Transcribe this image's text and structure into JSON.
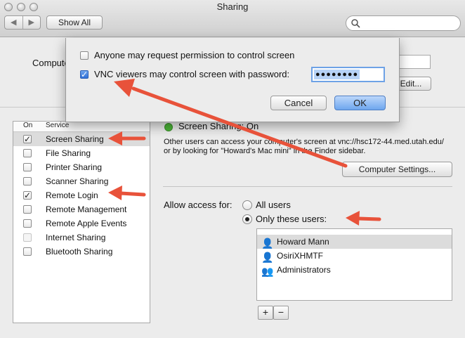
{
  "window": {
    "title": "Sharing"
  },
  "toolbar": {
    "back_icon": "chevron-left-icon",
    "forward_icon": "chevron-right-icon",
    "show_all_label": "Show All",
    "search_icon": "magnifier-icon"
  },
  "computer_name": {
    "label": "Computer Name:",
    "edit_label": "Edit..."
  },
  "services": {
    "header_on": "On",
    "header_service": "Service",
    "items": [
      {
        "label": "Screen Sharing",
        "checked": true,
        "selected": true
      },
      {
        "label": "File Sharing",
        "checked": false
      },
      {
        "label": "Printer Sharing",
        "checked": false
      },
      {
        "label": "Scanner Sharing",
        "checked": false
      },
      {
        "label": "Remote Login",
        "checked": true
      },
      {
        "label": "Remote Management",
        "checked": false
      },
      {
        "label": "Remote Apple Events",
        "checked": false
      },
      {
        "label": "Internet Sharing",
        "checked": false,
        "disabled": true
      },
      {
        "label": "Bluetooth Sharing",
        "checked": false
      }
    ]
  },
  "status": {
    "title": "Screen Sharing: On",
    "description": "Other users can access your computer's screen at vnc://hsc172-44.med.utah.edu/ or by looking for \"Howard's Mac mini\" in the Finder sidebar.",
    "status_color": "#4cb538"
  },
  "computer_settings_label": "Computer Settings...",
  "access": {
    "label": "Allow access for:",
    "options": [
      {
        "label": "All users",
        "selected": false
      },
      {
        "label": "Only these users:",
        "selected": true
      }
    ],
    "users": [
      {
        "name": "Howard Mann",
        "icon": "user-icon",
        "selected": true
      },
      {
        "name": "OsiriXHMTF",
        "icon": "user-icon"
      },
      {
        "name": "Administrators",
        "icon": "group-icon"
      }
    ],
    "add_label": "+",
    "remove_label": "−"
  },
  "sheet": {
    "anyone_label": "Anyone may request permission to control screen",
    "anyone_checked": false,
    "vnc_label": "VNC viewers may control screen with password:",
    "vnc_checked": true,
    "password_mask": "●●●●●●●●",
    "cancel_label": "Cancel",
    "ok_label": "OK"
  },
  "colors": {
    "annotation_arrow": "#e8523a",
    "default_button": "#7fb0ee"
  }
}
